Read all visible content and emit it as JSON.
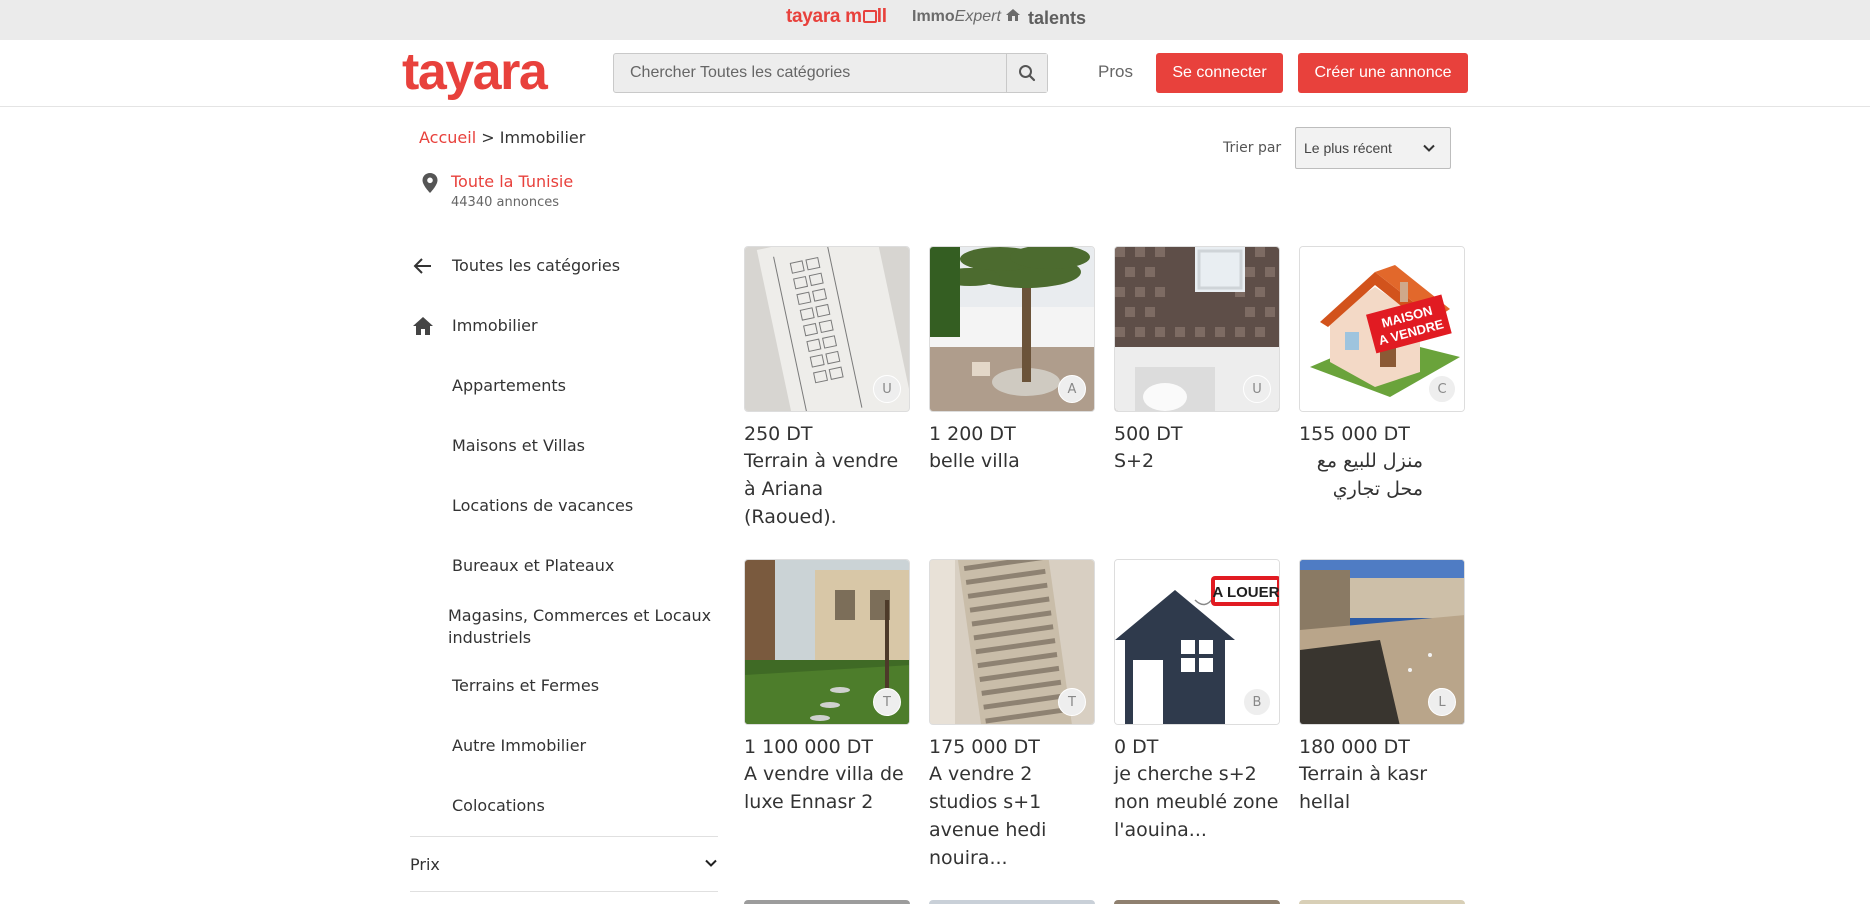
{
  "brands": {
    "mall": "tayara mall",
    "mall_prefix": "tayara m",
    "mall_suffix": "ll",
    "immo_bold": "Immo",
    "immo_italic": "Expert",
    "talents": "talents"
  },
  "header": {
    "logo": "tayara",
    "search_placeholder": "Chercher Toutes les catégories",
    "pros": "Pros",
    "login": "Se connecter",
    "create": "Créer une annonce"
  },
  "breadcrumb": {
    "home": "Accueil",
    "separator": " > ",
    "current": "Immobilier"
  },
  "location": {
    "name": "Toute la Tunisie",
    "count": "44340 annonces"
  },
  "sort": {
    "label": "Trier par",
    "value": "Le plus récent"
  },
  "sidebar": {
    "back": "Toutes les catégories",
    "parent": "Immobilier",
    "items": [
      "Appartements",
      "Maisons et Villas",
      "Locations de vacances",
      "Bureaux et Plateaux",
      "Magasins, Commerces et Locaux industriels",
      "Terrains et Fermes",
      "Autre Immobilier",
      "Colocations"
    ],
    "prix": "Prix"
  },
  "listings": [
    {
      "price": "250 DT",
      "title": "Terrain à vendre à Ariana (Raoued).",
      "badge": "U"
    },
    {
      "price": "1 200 DT",
      "title": "belle villa",
      "badge": "A"
    },
    {
      "price": "500 DT",
      "title": "S+2",
      "badge": "U"
    },
    {
      "price": "155 000 DT",
      "title": "منزل للبيع مع محل تجاري",
      "badge": "C",
      "image_text": "MAISON A VENDRE"
    },
    {
      "price": "1 100 000 DT",
      "title": "A vendre villa de luxe Ennasr 2",
      "badge": "T"
    },
    {
      "price": "175 000 DT",
      "title": "A vendre 2 studios s+1 avenue hedi nouira...",
      "badge": "T"
    },
    {
      "price": "0 DT",
      "title": "je cherche s+2 non meublé zone l'aouina...",
      "badge": "B",
      "image_text": "A LOUER"
    },
    {
      "price": "180 000 DT",
      "title": "Terrain à kasr hellal",
      "badge": "L"
    }
  ],
  "colors": {
    "brand_red": "#e8413c",
    "text": "#333333",
    "muted": "#666666"
  }
}
